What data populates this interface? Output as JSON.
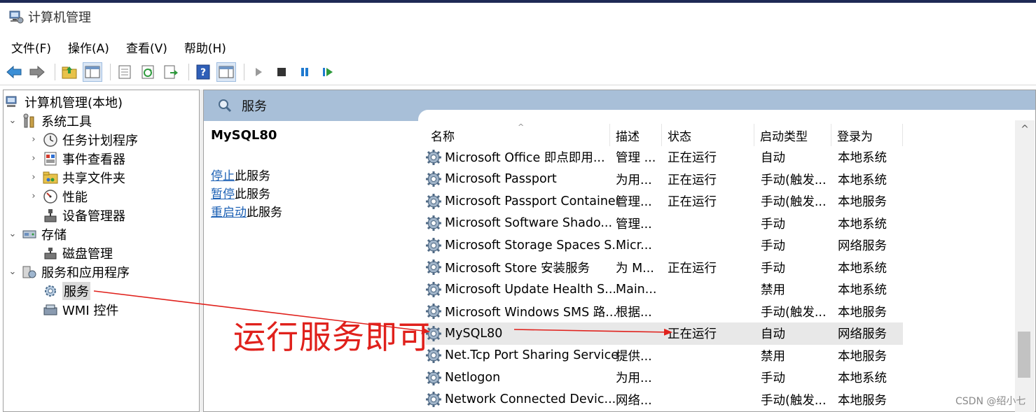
{
  "window": {
    "title": "计算机管理"
  },
  "menu": [
    {
      "label": "文件(F)"
    },
    {
      "label": "操作(A)"
    },
    {
      "label": "查看(V)"
    },
    {
      "label": "帮助(H)"
    }
  ],
  "toolbar": {
    "buttons": [
      "back-icon",
      "forward-icon",
      "up-folder-icon",
      "show-hide-tree-icon",
      "properties-icon",
      "refresh-icon",
      "export-list-icon",
      "help-icon",
      "action-pane-icon",
      "start-service-icon",
      "stop-service-icon",
      "pause-service-icon",
      "resume-service-icon"
    ]
  },
  "tree": {
    "root": "计算机管理(本地)",
    "items": [
      {
        "label": "系统工具",
        "expander": "⌄"
      },
      {
        "label": "任务计划程序",
        "expander": "›"
      },
      {
        "label": "事件查看器",
        "expander": "›"
      },
      {
        "label": "共享文件夹",
        "expander": "›"
      },
      {
        "label": "性能",
        "expander": "›"
      },
      {
        "label": "设备管理器",
        "expander": ""
      },
      {
        "label": "存储",
        "expander": "⌄"
      },
      {
        "label": "磁盘管理",
        "expander": ""
      },
      {
        "label": "服务和应用程序",
        "expander": "⌄"
      },
      {
        "label": "服务",
        "expander": ""
      },
      {
        "label": "WMI 控件",
        "expander": ""
      }
    ]
  },
  "services_panel": {
    "header": "服务",
    "selected_service": "MySQL80",
    "actions": [
      {
        "link": "停止",
        "rest": "此服务"
      },
      {
        "link": "暂停",
        "rest": "此服务"
      },
      {
        "link": "重启动",
        "rest": "此服务"
      }
    ],
    "columns": [
      "名称",
      "描述",
      "状态",
      "启动类型",
      "登录为"
    ],
    "rows": [
      {
        "name": "Microsoft Office 即点即用...",
        "desc": "管理 ...",
        "status": "正在运行",
        "startup": "自动",
        "logon": "本地系统"
      },
      {
        "name": "Microsoft Passport",
        "desc": "为用...",
        "status": "正在运行",
        "startup": "手动(触发...",
        "logon": "本地系统"
      },
      {
        "name": "Microsoft Passport Container",
        "desc": "管理...",
        "status": "正在运行",
        "startup": "手动(触发...",
        "logon": "本地服务"
      },
      {
        "name": "Microsoft Software Shado...",
        "desc": "管理...",
        "status": "",
        "startup": "手动",
        "logon": "本地系统"
      },
      {
        "name": "Microsoft Storage Spaces S...",
        "desc": "Micr...",
        "status": "",
        "startup": "手动",
        "logon": "网络服务"
      },
      {
        "name": "Microsoft Store 安装服务",
        "desc": "为 M...",
        "status": "正在运行",
        "startup": "手动",
        "logon": "本地系统"
      },
      {
        "name": "Microsoft Update Health S...",
        "desc": "Main...",
        "status": "",
        "startup": "禁用",
        "logon": "本地系统"
      },
      {
        "name": "Microsoft Windows SMS 路...",
        "desc": "根据...",
        "status": "",
        "startup": "手动(触发...",
        "logon": "本地服务"
      },
      {
        "name": "MySQL80",
        "desc": "",
        "status": "正在运行",
        "startup": "自动",
        "logon": "网络服务"
      },
      {
        "name": "Net.Tcp Port Sharing Service",
        "desc": "提供...",
        "status": "",
        "startup": "禁用",
        "logon": "本地服务"
      },
      {
        "name": "Netlogon",
        "desc": "为用...",
        "status": "",
        "startup": "手动",
        "logon": "本地系统"
      },
      {
        "name": "Network Connected Devic...",
        "desc": "网络...",
        "status": "",
        "startup": "手动(触发...",
        "logon": "本地服务"
      }
    ]
  },
  "annotation": {
    "text": "运行服务即可",
    "color": "#e0211c"
  },
  "watermark": "CSDN @绍小七",
  "colors": {
    "header_band": "#a8bfd8",
    "link": "#1a5fb4",
    "title_accent": "#1e2a55"
  }
}
